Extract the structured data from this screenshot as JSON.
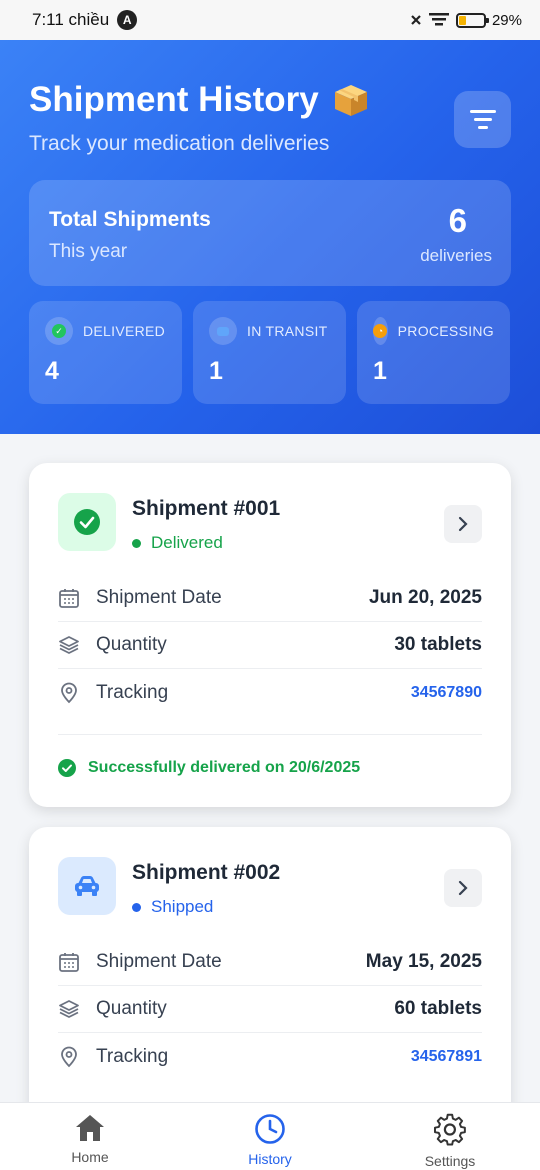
{
  "status_bar": {
    "time": "7:11 chiều",
    "battery": "29%"
  },
  "header": {
    "title": "Shipment History",
    "subtitle": "Track your medication deliveries",
    "icon": "package-icon"
  },
  "summary": {
    "title": "Total Shipments",
    "subtitle": "This year",
    "count": "6",
    "unit": "deliveries"
  },
  "stats": [
    {
      "label": "DELIVERED",
      "value": "4",
      "color": "#22c55e"
    },
    {
      "label": "IN TRANSIT",
      "value": "1",
      "color": "#60a5fa"
    },
    {
      "label": "PROCESSING",
      "value": "1",
      "color": "#f59e0b"
    }
  ],
  "shipments": [
    {
      "title": "Shipment #001",
      "status": "Delivered",
      "status_color": "#16a34a",
      "icon": "check-circle-icon",
      "rows": [
        {
          "label": "Shipment Date",
          "value": "Jun 20, 2025"
        },
        {
          "label": "Quantity",
          "value": "30 tablets"
        },
        {
          "label": "Tracking",
          "value": "34567890"
        }
      ],
      "footer": "Successfully delivered on 20/6/2025"
    },
    {
      "title": "Shipment #002",
      "status": "Shipped",
      "status_color": "#2563eb",
      "icon": "car-icon",
      "rows": [
        {
          "label": "Shipment Date",
          "value": "May 15, 2025"
        },
        {
          "label": "Quantity",
          "value": "60 tablets"
        },
        {
          "label": "Tracking",
          "value": "34567891"
        }
      ]
    }
  ],
  "nav": [
    {
      "label": "Home",
      "icon": "home-icon"
    },
    {
      "label": "History",
      "icon": "clock-icon",
      "active": true
    },
    {
      "label": "Settings",
      "icon": "gear-icon"
    }
  ]
}
